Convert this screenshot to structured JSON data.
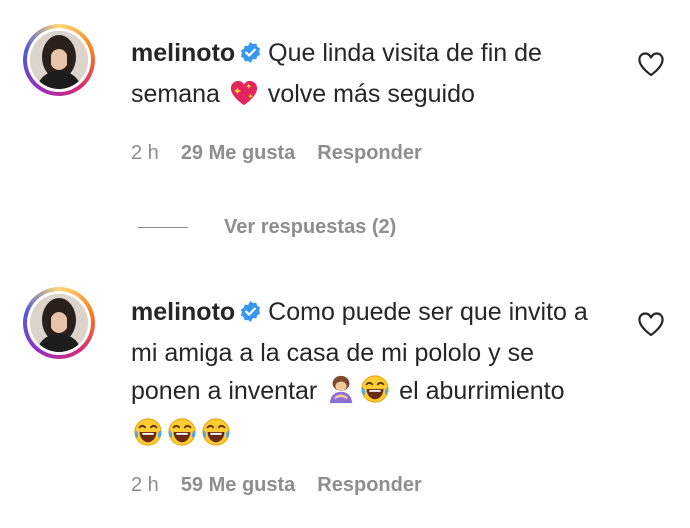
{
  "comments": [
    {
      "username": "melinoto",
      "text_parts": [
        "Que linda visita de fin de semana",
        " volve más seguido"
      ],
      "emojis": [
        "sparkling-heart"
      ],
      "time": "2 h",
      "likes": "29 Me gusta",
      "reply_label": "Responder"
    },
    {
      "username": "melinoto",
      "text_parts": [
        "Como puede ser que invito a mi amiga a la casa de mi pololo y se ponen a inventar",
        " el aburrimiento"
      ],
      "emojis": [
        "person-bowing",
        "tears-of-joy",
        "tears-of-joy",
        "tears-of-joy",
        "tears-of-joy"
      ],
      "time": "2 h",
      "likes": "59 Me gusta",
      "reply_label": "Responder"
    }
  ],
  "view_replies_label": "Ver respuestas (2)",
  "icons": [
    "verified-badge-icon",
    "heart-outline-icon",
    "avatar"
  ],
  "colors": {
    "verified": "#3897f0",
    "muted": "#8e8e8e",
    "text": "#262626"
  }
}
